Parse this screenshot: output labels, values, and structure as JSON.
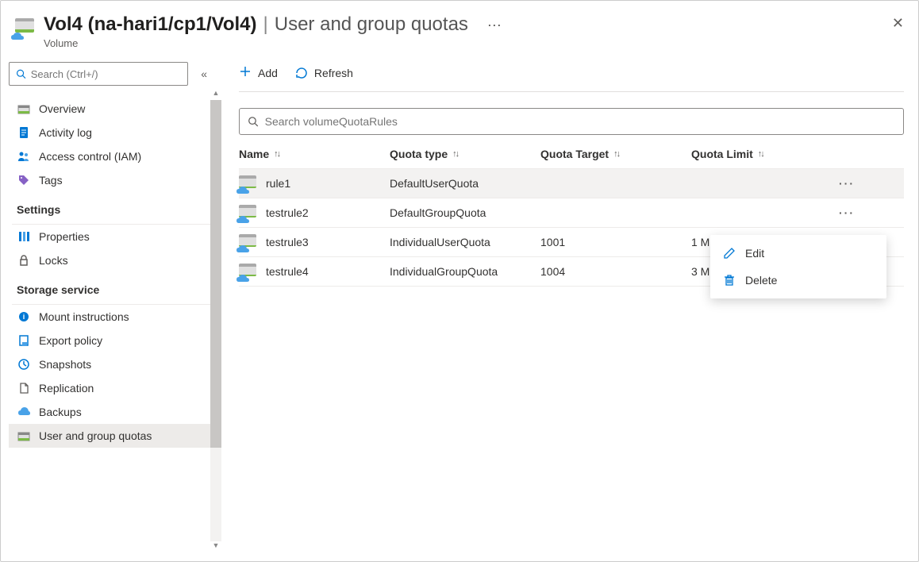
{
  "header": {
    "title_main": "Vol4 (na-hari1/cp1/Vol4)",
    "title_page": "User and group quotas",
    "subtitle": "Volume"
  },
  "sidebar": {
    "search_placeholder": "Search (Ctrl+/)",
    "items_top": [
      {
        "label": "Overview",
        "icon": "overview"
      },
      {
        "label": "Activity log",
        "icon": "activity"
      },
      {
        "label": "Access control (IAM)",
        "icon": "iam"
      },
      {
        "label": "Tags",
        "icon": "tags"
      }
    ],
    "section_settings": "Settings",
    "items_settings": [
      {
        "label": "Properties",
        "icon": "properties"
      },
      {
        "label": "Locks",
        "icon": "locks"
      }
    ],
    "section_storage": "Storage service",
    "items_storage": [
      {
        "label": "Mount instructions",
        "icon": "mount"
      },
      {
        "label": "Export policy",
        "icon": "export"
      },
      {
        "label": "Snapshots",
        "icon": "snapshots"
      },
      {
        "label": "Replication",
        "icon": "replication"
      },
      {
        "label": "Backups",
        "icon": "backups"
      },
      {
        "label": "User and group quotas",
        "icon": "quotas",
        "selected": true
      }
    ]
  },
  "toolbar": {
    "add_label": "Add",
    "refresh_label": "Refresh"
  },
  "filter": {
    "placeholder": "Search volumeQuotaRules"
  },
  "table": {
    "columns": [
      "Name",
      "Quota type",
      "Quota Target",
      "Quota Limit"
    ],
    "rows": [
      {
        "name": "rule1",
        "type": "DefaultUserQuota",
        "target": "",
        "limit": "",
        "highlighted": true
      },
      {
        "name": "testrule2",
        "type": "DefaultGroupQuota",
        "target": "",
        "limit": ""
      },
      {
        "name": "testrule3",
        "type": "IndividualUserQuota",
        "target": "1001",
        "limit": "1 MiB"
      },
      {
        "name": "testrule4",
        "type": "IndividualGroupQuota",
        "target": "1004",
        "limit": "3 MiB"
      }
    ]
  },
  "context_menu": {
    "edit": "Edit",
    "delete": "Delete"
  }
}
